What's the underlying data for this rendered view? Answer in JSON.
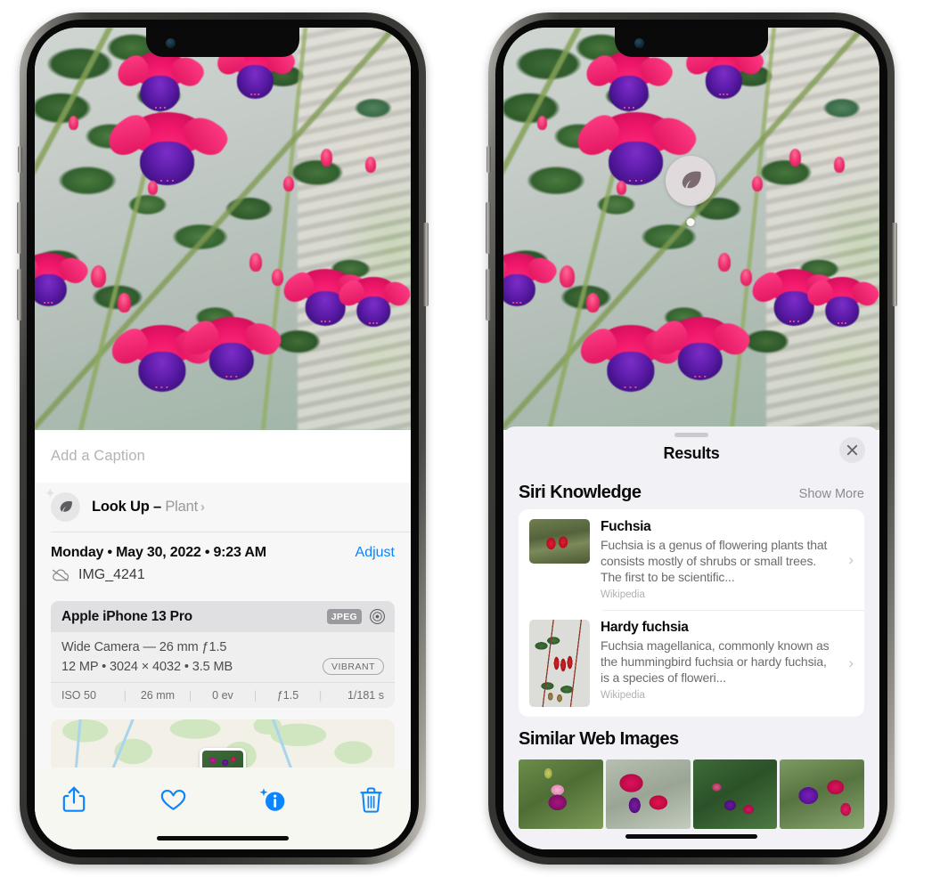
{
  "left_phone": {
    "photo_alt": "fuchsia-flowers-photo",
    "caption": {
      "placeholder": "Add a Caption",
      "value": ""
    },
    "lookup": {
      "icon": "leaf-icon",
      "sparkle_icon": "sparkle-icon",
      "label": "Look Up",
      "separator": " – ",
      "subject": "Plant",
      "chevron": "›"
    },
    "meta": {
      "date": "Monday • May 30, 2022 • 9:23 AM",
      "adjust_label": "Adjust",
      "cloud_icon": "cloud-slash-icon",
      "filename": "IMG_4241"
    },
    "exif": {
      "model": "Apple iPhone 13 Pro",
      "format_chip": "JPEG",
      "aperture_icon": "aperture-icon",
      "lens": "Wide Camera — 26 mm ƒ1.5",
      "size": "12 MP • 3024 × 4032 • 3.5 MB",
      "style_chip": "VIBRANT",
      "stats": [
        "ISO 50",
        "26 mm",
        "0 ev",
        "ƒ1.5",
        "1/181 s"
      ]
    },
    "map": {
      "name": "location-map-thumbnail",
      "pin": "photo-pin"
    },
    "toolbar": [
      {
        "name": "share-button",
        "icon": "share-icon"
      },
      {
        "name": "favorite-button",
        "icon": "heart-icon"
      },
      {
        "name": "info-button",
        "icon": "info-sparkle-icon"
      },
      {
        "name": "delete-button",
        "icon": "trash-icon"
      }
    ],
    "accent_color": "#0a84ff"
  },
  "right_phone": {
    "photo_alt": "fuchsia-flowers-photo",
    "visual_look_up_pin": {
      "icon": "leaf-icon",
      "name": "visual-look-up-badge"
    },
    "sheet": {
      "grabber": "sheet-grabber",
      "title": "Results",
      "close_icon": "close-icon"
    },
    "siri_knowledge": {
      "heading": "Siri Knowledge",
      "action": "Show More",
      "items": [
        {
          "title": "Fuchsia",
          "desc": "Fuchsia is a genus of flowering plants that consists mostly of shrubs or small trees. The first to be scientific...",
          "source": "Wikipedia",
          "thumb": "fuchsia-red-flowers-thumbnail",
          "chevron": "›"
        },
        {
          "title": "Hardy fuchsia",
          "desc": "Fuchsia magellanica, commonly known as the hummingbird fuchsia or hardy fuchsia, is a species of floweri...",
          "source": "Wikipedia",
          "thumb": "hardy-fuchsia-specimen-thumbnail",
          "chevron": "›"
        }
      ]
    },
    "similar_web_images": {
      "heading": "Similar Web Images",
      "items": [
        {
          "name": "similar-image-1"
        },
        {
          "name": "similar-image-2"
        },
        {
          "name": "similar-image-3"
        },
        {
          "name": "similar-image-4"
        }
      ]
    }
  }
}
